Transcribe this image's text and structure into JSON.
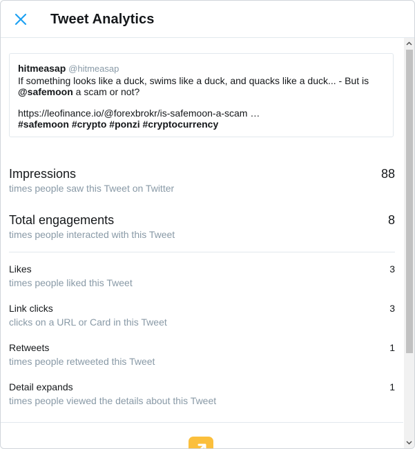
{
  "header": {
    "title": "Tweet Analytics",
    "close_icon": "close-icon"
  },
  "tweet": {
    "author": "hitmeasap",
    "handle": "@hitmeasap",
    "text_part1": "If something looks like a duck, swims like a duck, and quacks like a duck... - But is",
    "mention": "@safemoon",
    "text_part2": " a scam or not?",
    "link": "https://leofinance.io/@forexbrokr/is-safemoon-a-scam …",
    "hashtags": [
      "#safemoon",
      "#crypto",
      "#ponzi",
      "#cryptocurrency"
    ]
  },
  "metrics_primary": [
    {
      "label": "Impressions",
      "value": "88",
      "description": "times people saw this Tweet on Twitter"
    },
    {
      "label": "Total engagements",
      "value": "8",
      "description": "times people interacted with this Tweet"
    }
  ],
  "metrics_secondary": [
    {
      "label": "Likes",
      "value": "3",
      "description": "times people liked this Tweet"
    },
    {
      "label": "Link clicks",
      "value": "3",
      "description": "clicks on a URL or Card in this Tweet"
    },
    {
      "label": "Retweets",
      "value": "1",
      "description": "times people retweeted this Tweet"
    },
    {
      "label": "Detail expands",
      "value": "1",
      "description": "times people viewed the details about this Tweet"
    }
  ],
  "colors": {
    "accent": "#1da1f2",
    "muted": "#8899a6",
    "text": "#14171a",
    "promote": "#fbbf3c"
  }
}
